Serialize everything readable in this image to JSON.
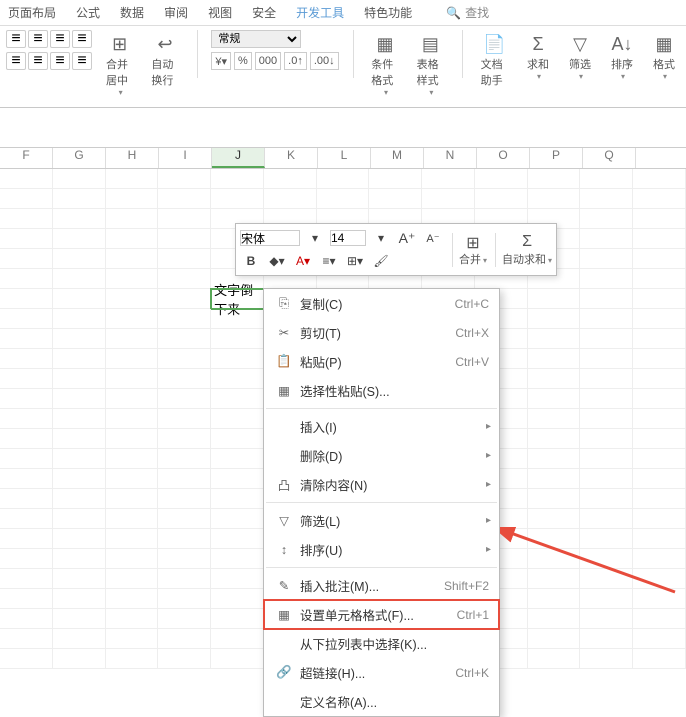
{
  "tabs": {
    "layout": "页面布局",
    "formula": "公式",
    "data": "数据",
    "review": "审阅",
    "view": "视图",
    "security": "安全",
    "devtools": "开发工具",
    "features": "特色功能",
    "search": "查找"
  },
  "ribbon": {
    "merge_center": "合并居中",
    "auto_wrap": "自动换行",
    "numfmt_label": "常规",
    "cond_fmt": "条件格式",
    "table_style": "表格样式",
    "doc_help": "文档助手",
    "sum": "求和",
    "filter": "筛选",
    "sort": "排序",
    "format": "格式"
  },
  "columns": [
    "F",
    "G",
    "H",
    "I",
    "J",
    "K",
    "L",
    "M",
    "N",
    "O",
    "P",
    "Q"
  ],
  "selected_col_index": 4,
  "cell_text": "文字倒下来",
  "mini": {
    "font": "宋体",
    "size": "14",
    "merge": "合并",
    "autosum": "自动求和"
  },
  "menu": [
    {
      "icon": "⎘",
      "label": "复制(C)",
      "shortcut": "Ctrl+C"
    },
    {
      "icon": "✂",
      "label": "剪切(T)",
      "shortcut": "Ctrl+X"
    },
    {
      "icon": "📋",
      "label": "粘贴(P)",
      "shortcut": "Ctrl+V"
    },
    {
      "icon": "▦",
      "label": "选择性粘贴(S)...",
      "shortcut": ""
    },
    {
      "hr": true
    },
    {
      "icon": "",
      "label": "插入(I)",
      "sub": true
    },
    {
      "icon": "",
      "label": "删除(D)",
      "sub": true
    },
    {
      "icon": "凸",
      "label": "清除内容(N)",
      "sub": true
    },
    {
      "hr": true
    },
    {
      "icon": "▽",
      "label": "筛选(L)",
      "sub": true
    },
    {
      "icon": "↕",
      "label": "排序(U)",
      "sub": true
    },
    {
      "hr": true
    },
    {
      "icon": "✎",
      "label": "插入批注(M)...",
      "shortcut": "Shift+F2"
    },
    {
      "icon": "▦",
      "label": "设置单元格格式(F)...",
      "shortcut": "Ctrl+1",
      "hl": true
    },
    {
      "icon": "",
      "label": "从下拉列表中选择(K)...",
      "shortcut": ""
    },
    {
      "icon": "🔗",
      "label": "超链接(H)...",
      "shortcut": "Ctrl+K"
    },
    {
      "icon": "",
      "label": "定义名称(A)...",
      "shortcut": ""
    }
  ]
}
